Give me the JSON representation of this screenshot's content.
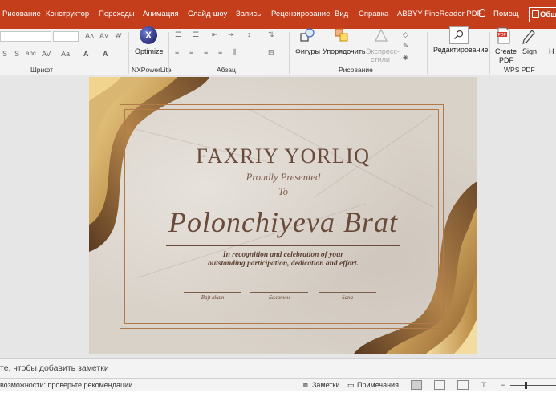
{
  "ribbon_tabs": [
    "Рисование",
    "Конструктор",
    "Переходы",
    "Анимация",
    "Слайд-шоу",
    "Запись",
    "Рецензирование",
    "Вид",
    "Справка",
    "ABBYY FineReader PDF",
    "Помощ",
    "Общ"
  ],
  "ribbon": {
    "groups": {
      "font": "Шрифт",
      "nxpowerlite": "NXPowerLite",
      "paragraph": "Абзац",
      "drawing": "Рисование",
      "wps_pdf": "WPS PDF"
    },
    "buttons": {
      "optimize": "Optimize",
      "shapes": "Фигуры",
      "arrange": "Упорядочить",
      "quick_styles_1": "Экспресс-",
      "quick_styles_2": "стили",
      "editing": "Редактирование",
      "create_pdf_1": "Create",
      "create_pdf_2": "PDF",
      "sign": "Sign",
      "overflow": "Н"
    }
  },
  "slide": {
    "title": "FAXRIY YORLIQ",
    "proudly": "Proudly Presented",
    "to": "To",
    "name": "Polonchiyeva Brat",
    "text_line1": "In recognition and celebration of your",
    "text_line2": "outstanding participation, dedication and effort.",
    "signatures": [
      "Bajt akam",
      "Балатон",
      "Sana"
    ]
  },
  "notes_placeholder": "те, чтобы добавить заметки",
  "status_bar": {
    "accessibility": "возможности: проверьте рекомендации",
    "notes_button": "Заметки",
    "comments_button": "Примечания"
  },
  "colors": {
    "ribbon_accent": "#c43e1c",
    "slide_gold": "#c9a05a",
    "slide_brown": "#6a4a3a"
  }
}
